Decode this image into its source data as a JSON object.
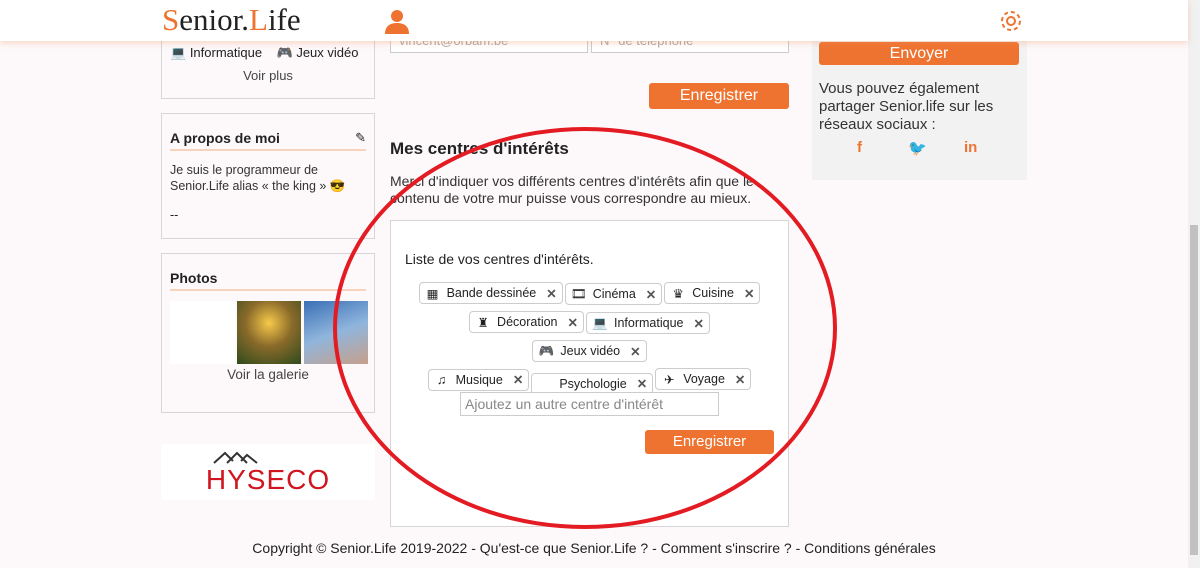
{
  "header": {
    "logo": "Senior.Life",
    "logo_initials": [
      "S",
      "L"
    ],
    "user_icon": "user-icon",
    "settings_icon": "gear-icon"
  },
  "left": {
    "interests_preview": [
      "Informatique",
      "Jeux vidéo"
    ],
    "see_more": "Voir plus",
    "about": {
      "title": "A propos de moi",
      "text": "Je suis le programmeur de Senior.Life alias « the king » 😎",
      "signature": "--"
    },
    "photos": {
      "title": "Photos",
      "gallery_link": "Voir la galerie"
    },
    "ad": {
      "brand": "HYSECO"
    }
  },
  "main": {
    "contact": {
      "email_value": "vincent@orbam.be",
      "phone_placeholder": "N° de téléphone",
      "save": "Enregistrer"
    },
    "interests": {
      "title": "Mes centres d'intérêts",
      "intro": "Merci d'indiquer vos différents centres d'intérêts afin que le contenu de votre mur puisse vous correspondre au mieux.",
      "list_label": "Liste de vos centres d'intérêts.",
      "tags": [
        {
          "label": "Bande dessinée",
          "icon": "comic-icon",
          "glyph": "▦"
        },
        {
          "label": "Cinéma",
          "icon": "film-icon",
          "glyph": "🎞"
        },
        {
          "label": "Cuisine",
          "icon": "chef-hat-icon",
          "glyph": "♛"
        },
        {
          "label": "Décoration",
          "icon": "stamp-icon",
          "glyph": "♜"
        },
        {
          "label": "Informatique",
          "icon": "laptop-icon",
          "glyph": "💻"
        },
        {
          "label": "Jeux vidéo",
          "icon": "gamepad-icon",
          "glyph": "🎮"
        },
        {
          "label": "Musique",
          "icon": "music-icon",
          "glyph": "♫"
        },
        {
          "label": "Psychologie",
          "icon": "",
          "glyph": ""
        },
        {
          "label": "Voyage",
          "icon": "plane-icon",
          "glyph": "✈"
        }
      ],
      "remove_glyph": "✕",
      "add_placeholder": "Ajoutez un autre centre d'intérêt",
      "save": "Enregistrer"
    }
  },
  "right": {
    "send": "Envoyer",
    "share_text": "Vous pouvez également partager Senior.life sur les réseaux sociaux :",
    "socials": [
      "f",
      "t",
      "in"
    ]
  },
  "footer": {
    "copyright": "Copyright © Senior.Life 2019-2022",
    "links": [
      "Qu'est-ce que Senior.Life ?",
      "Comment s'inscrire ?",
      "Conditions générales"
    ],
    "sep": " - "
  },
  "colors": {
    "accent": "#ef7330",
    "annotation": "#e31b23"
  }
}
